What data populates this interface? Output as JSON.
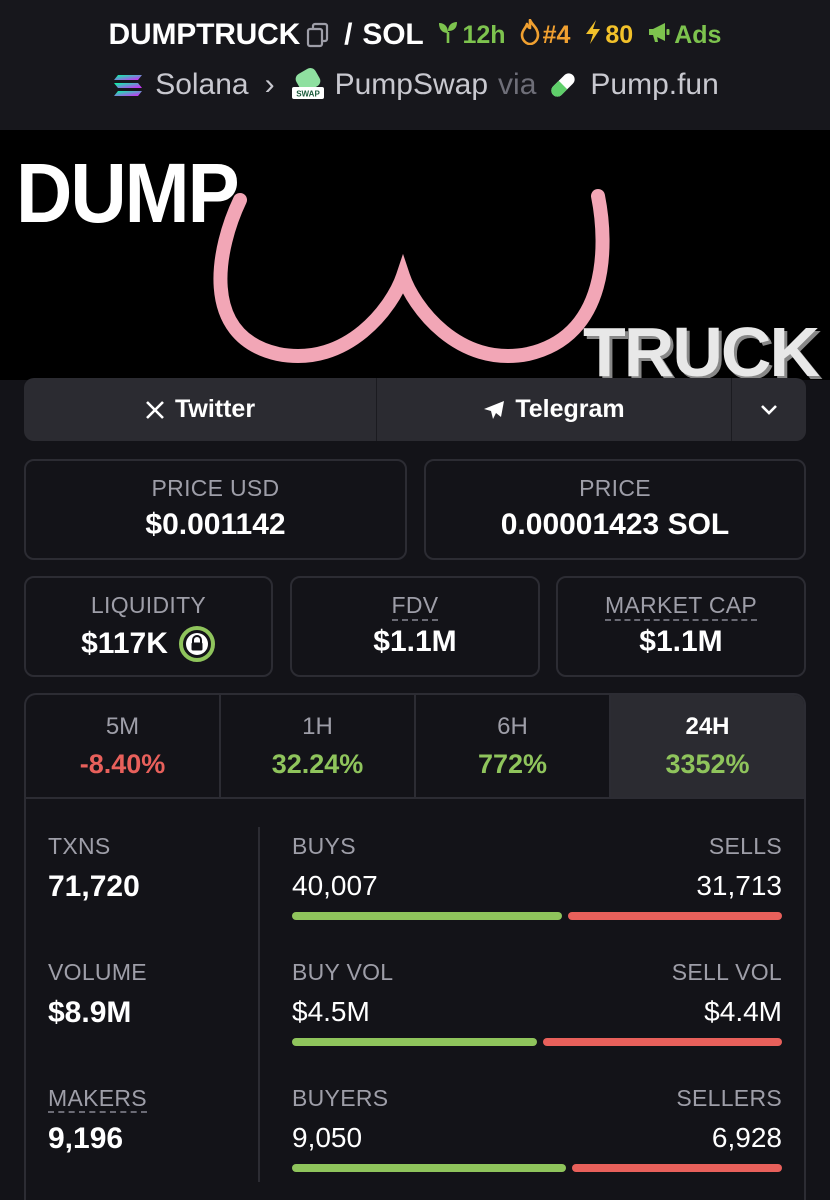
{
  "header": {
    "token": "DUMPTRUCK",
    "quote": "SOL",
    "separator": "/",
    "age": "12h",
    "rank": "#4",
    "boosts": "80",
    "ads_label": "Ads"
  },
  "breadcrumb": {
    "chain": "Solana",
    "dex": "PumpSwap",
    "via": "via",
    "launchpad": "Pump.fun"
  },
  "banner": {
    "top_text": "DUMP",
    "bottom_text": "TRUCK"
  },
  "socials": {
    "twitter": "Twitter",
    "telegram": "Telegram"
  },
  "prices": {
    "price_usd_label": "PRICE USD",
    "price_usd": "$0.001142",
    "price_label": "PRICE",
    "price_native": "0.00001423 SOL"
  },
  "stats": {
    "liquidity_label": "LIQUIDITY",
    "liquidity": "$117K",
    "fdv_label": "FDV",
    "fdv": "$1.1M",
    "mcap_label": "MARKET CAP",
    "mcap": "$1.1M"
  },
  "timeframes": [
    {
      "label": "5M",
      "change": "-8.40%",
      "direction": "down"
    },
    {
      "label": "1H",
      "change": "32.24%",
      "direction": "up"
    },
    {
      "label": "6H",
      "change": "772%",
      "direction": "up"
    },
    {
      "label": "24H",
      "change": "3352%",
      "direction": "up",
      "active": true
    }
  ],
  "txns": {
    "label": "TXNS",
    "value": "71,720",
    "buys_label": "BUYS",
    "buys": "40,007",
    "buys_count": 40007,
    "sells_label": "SELLS",
    "sells": "31,713",
    "sells_count": 31713
  },
  "volume": {
    "label": "VOLUME",
    "value": "$8.9M",
    "buy_label": "BUY VOL",
    "buy": "$4.5M",
    "buy_amount": 4.5,
    "sell_label": "SELL VOL",
    "sell": "$4.4M",
    "sell_amount": 4.4
  },
  "makers": {
    "label": "MAKERS",
    "value": "9,196",
    "buyers_label": "BUYERS",
    "buyers": "9,050",
    "buyers_count": 9050,
    "sellers_label": "SELLERS",
    "sellers": "6,928",
    "sellers_count": 6928
  },
  "colors": {
    "positive": "#8fc45c",
    "negative": "#e8605b",
    "background": "#131318",
    "panel": "#2b2b31"
  }
}
